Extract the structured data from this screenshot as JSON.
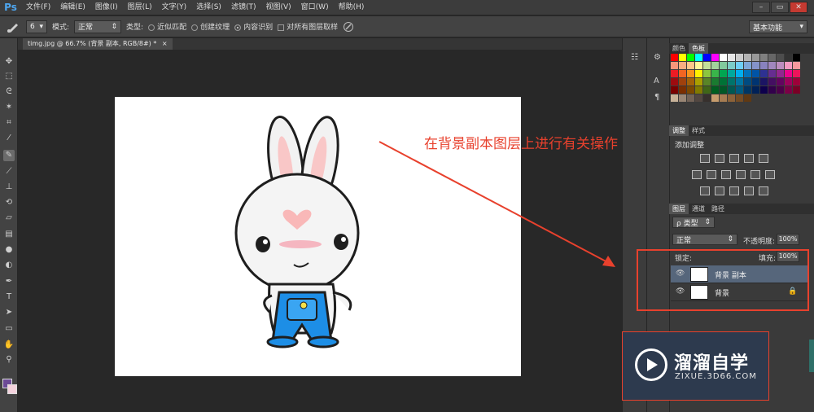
{
  "app": {
    "logo": "Ps"
  },
  "menu": [
    "文件(F)",
    "编辑(E)",
    "图像(I)",
    "图层(L)",
    "文字(Y)",
    "选择(S)",
    "滤镜(T)",
    "视图(V)",
    "窗口(W)",
    "帮助(H)"
  ],
  "window_controls": {
    "minimize": "–",
    "restore": "▭",
    "close": "✕"
  },
  "options": {
    "brush_size": "6",
    "mode_label": "模式:",
    "mode_value": "正常",
    "type_label": "类型:",
    "type_options": [
      "近似匹配",
      "创建纹理",
      "内容识别"
    ],
    "selected_type": "内容识别",
    "sample_all_label": "对所有图层取样",
    "workspace": "基本功能"
  },
  "document": {
    "tab_title": "timg.jpg @ 66.7% (背景 副本, RGB/8#) *",
    "tab_close": "×"
  },
  "annotation": "在背景副本图层上进行有关操作",
  "colors": {
    "annotation": "#e8412d",
    "foreground": "#6d4a96",
    "background": "#f3d2dc",
    "accent": "#4ea6ef"
  },
  "panels": {
    "swatches": {
      "tabs": [
        "颜色",
        "色板"
      ],
      "active_tab": "色板"
    },
    "adjustments": {
      "tabs": [
        "调整",
        "样式"
      ],
      "active_tab": "调整",
      "title": "添加调整"
    },
    "layers": {
      "tabs": [
        "图层",
        "通道",
        "路径"
      ],
      "active_tab": "图层",
      "filter_label": "ρ 类型",
      "blend_mode": "正常",
      "opacity_label": "不透明度:",
      "opacity": "100%",
      "lock_label": "锁定:",
      "fill_label": "填充:",
      "fill": "100%",
      "items": [
        {
          "name": "背景 副本",
          "visible": true,
          "selected": true,
          "locked": false
        },
        {
          "name": "背景",
          "visible": true,
          "selected": false,
          "locked": true
        }
      ]
    }
  },
  "watermark": {
    "title": "溜溜自学",
    "url": "ZIXUE.3D66.COM"
  },
  "icons": [
    "brush-icon",
    "move-tool-icon",
    "marquee-tool-icon",
    "lasso-tool-icon",
    "magic-wand-icon",
    "crop-tool-icon",
    "eyedropper-icon",
    "spot-healing-brush-icon",
    "brush-tool-icon",
    "stamp-tool-icon",
    "history-brush-icon",
    "eraser-icon",
    "gradient-icon",
    "blur-icon",
    "dodge-icon",
    "pen-tool-icon",
    "type-tool-icon",
    "path-select-icon",
    "shape-tool-icon",
    "hand-tool-icon",
    "zoom-tool-icon",
    "eye-icon",
    "lock-icon",
    "play-logo-icon"
  ]
}
